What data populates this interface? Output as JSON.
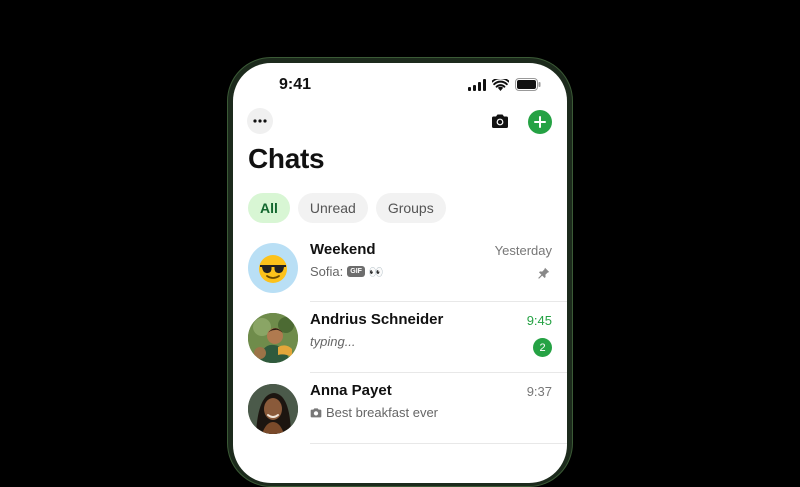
{
  "status_bar": {
    "time": "9:41",
    "icons": [
      "signal-icon",
      "wifi-icon",
      "battery-icon"
    ]
  },
  "header": {
    "title": "Chats",
    "left_button_icon": "more-icon",
    "right_buttons": [
      "camera-icon",
      "new-chat-icon"
    ]
  },
  "filters": [
    {
      "label": "All",
      "active": true
    },
    {
      "label": "Unread",
      "active": false
    },
    {
      "label": "Groups",
      "active": false
    }
  ],
  "chats": [
    {
      "name": "Weekend",
      "preview_sender": "Sofia:",
      "preview_badge": "GIF",
      "preview_extra": "👀",
      "time": "Yesterday",
      "pinned": true,
      "avatar": "sunglasses-emoji-icon"
    },
    {
      "name": "Andrius Schneider",
      "preview": "typing...",
      "time": "9:45",
      "unread_count": "2",
      "avatar": "photo-avatar"
    },
    {
      "name": "Anna Payet",
      "preview": "Best breakfast ever",
      "time": "9:37",
      "avatar": "photo-avatar",
      "preview_icon": "camera-icon"
    }
  ],
  "colors": {
    "accent": "#25a244",
    "chip_active_bg": "#d8f6d4",
    "chip_bg": "#f2f2f2"
  }
}
